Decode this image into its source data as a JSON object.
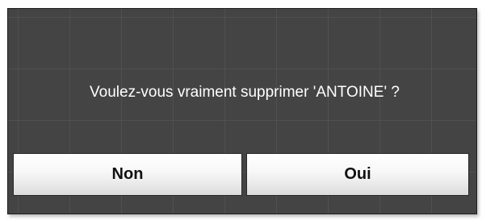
{
  "dialog": {
    "message": "Voulez-vous vraiment supprimer 'ANTOINE' ?",
    "buttons": {
      "no_label": "Non",
      "yes_label": "Oui"
    }
  },
  "colors": {
    "dialog_background": "#444444",
    "button_background": "#f5f5f5",
    "message_text": "#ffffff"
  }
}
